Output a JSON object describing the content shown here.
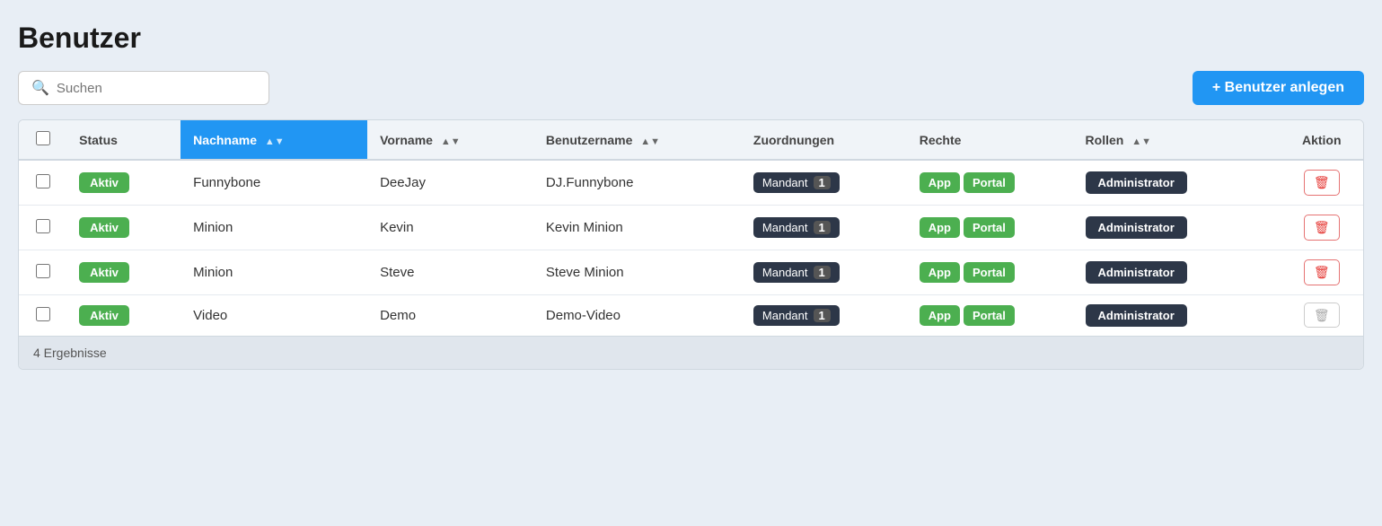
{
  "page": {
    "title": "Benutzer",
    "add_button": "+ Benutzer anlegen",
    "result_count": "4 Ergebnisse"
  },
  "search": {
    "placeholder": "Suchen"
  },
  "table": {
    "columns": [
      {
        "key": "checkbox",
        "label": ""
      },
      {
        "key": "status",
        "label": "Status"
      },
      {
        "key": "nachname",
        "label": "Nachname",
        "sorted": true,
        "sort_dir": "asc"
      },
      {
        "key": "vorname",
        "label": "Vorname",
        "sort": true
      },
      {
        "key": "benutzername",
        "label": "Benutzername",
        "sort": true
      },
      {
        "key": "zuordnungen",
        "label": "Zuordnungen"
      },
      {
        "key": "rechte",
        "label": "Rechte"
      },
      {
        "key": "rollen",
        "label": "Rollen",
        "sort": true
      },
      {
        "key": "aktion",
        "label": "Aktion"
      }
    ],
    "rows": [
      {
        "status": "Aktiv",
        "nachname": "Funnybone",
        "vorname": "DeeJay",
        "benutzername": "DJ.Funnybone",
        "zuordnung_label": "Mandant",
        "zuordnung_count": "1",
        "rechte": [
          "App",
          "Portal"
        ],
        "rolle": "Administrator",
        "deletable": true
      },
      {
        "status": "Aktiv",
        "nachname": "Minion",
        "vorname": "Kevin",
        "benutzername": "Kevin Minion",
        "zuordnung_label": "Mandant",
        "zuordnung_count": "1",
        "rechte": [
          "App",
          "Portal"
        ],
        "rolle": "Administrator",
        "deletable": true
      },
      {
        "status": "Aktiv",
        "nachname": "Minion",
        "vorname": "Steve",
        "benutzername": "Steve Minion",
        "zuordnung_label": "Mandant",
        "zuordnung_count": "1",
        "rechte": [
          "App",
          "Portal"
        ],
        "rolle": "Administrator",
        "deletable": true
      },
      {
        "status": "Aktiv",
        "nachname": "Video",
        "vorname": "Demo",
        "benutzername": "Demo-Video",
        "zuordnung_label": "Mandant",
        "zuordnung_count": "1",
        "rechte": [
          "App",
          "Portal"
        ],
        "rolle": "Administrator",
        "deletable": false
      }
    ]
  }
}
